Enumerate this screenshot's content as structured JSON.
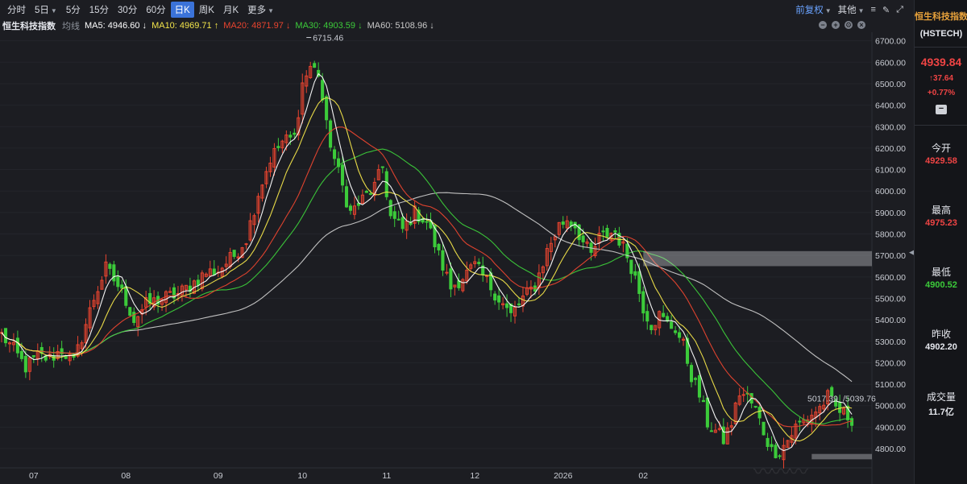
{
  "toolbar": {
    "items": [
      "分时",
      "5日",
      "5分",
      "15分",
      "30分",
      "60分",
      "日K",
      "周K",
      "月K",
      "更多"
    ],
    "active": "日K",
    "fuquan": "前复权",
    "other": "其他"
  },
  "legend": {
    "name": "恒生科技指数",
    "sub": "均线",
    "ma5": "MA5: 4946.60 ↓",
    "ma10": "MA10: 4969.71 ↑",
    "ma20": "MA20: 4871.97 ↓",
    "ma30": "MA30: 4903.59 ↓",
    "ma60": "MA60: 5108.96 ↓"
  },
  "colors": {
    "ma5": "#ffffff",
    "ma10": "#f2e44a",
    "ma20": "#e8442f",
    "ma30": "#3ccb3a",
    "ma60": "#c9c9c9",
    "up": "#e8442f",
    "down": "#3ccb3a"
  },
  "panel": {
    "title": "恒生科技指数",
    "code": "(HSTECH)",
    "price": "4939.84",
    "change": "↑37.64",
    "pct": "+0.77%",
    "open_label": "今开",
    "open": "4929.58",
    "high_label": "最高",
    "high": "4975.23",
    "low_label": "最低",
    "low": "4900.52",
    "prev_label": "昨收",
    "prev": "4902.20",
    "vol_label": "成交量",
    "vol": "11.7亿"
  },
  "chart_data": {
    "type": "candlestick",
    "y_ticks": [
      4800,
      4900,
      5000,
      5100,
      5200,
      5300,
      5400,
      5500,
      5600,
      5700,
      5800,
      5900,
      6000,
      6100,
      6200,
      6300,
      6400,
      6500,
      6600,
      6700
    ],
    "y_tick_labels": [
      "4800.00",
      "4900.00",
      "5000.00",
      "5100.00",
      "5200.00",
      "5300.00",
      "5400.00",
      "5500.00",
      "5600.00",
      "5700.00",
      "5800.00",
      "5900.00",
      "6000.00",
      "6100.00",
      "6200.00",
      "6300.00",
      "6400.00",
      "6500.00",
      "6600.00",
      "6700.00"
    ],
    "ylim": [
      4710,
      6740
    ],
    "x_labels": [
      "07",
      "08",
      "09",
      "10",
      "11",
      "12",
      "2026",
      "02"
    ],
    "x_label_days": [
      8,
      31,
      54,
      75,
      96,
      118,
      140,
      160
    ],
    "annotations": [
      {
        "text": "6715.46",
        "day": 76,
        "value": 6715.46
      },
      {
        "text": "5017.39",
        "day": 215,
        "value": 5017.39
      },
      {
        "text": "5039.76",
        "day": 218,
        "value": 5039.76
      }
    ],
    "close_keypoints": [
      [
        0,
        5330
      ],
      [
        3,
        5260
      ],
      [
        6,
        5180
      ],
      [
        9,
        5230
      ],
      [
        12,
        5220
      ],
      [
        15,
        5260
      ],
      [
        18,
        5200
      ],
      [
        20,
        5320
      ],
      [
        23,
        5500
      ],
      [
        26,
        5640
      ],
      [
        29,
        5560
      ],
      [
        31,
        5490
      ],
      [
        33,
        5400
      ],
      [
        36,
        5470
      ],
      [
        40,
        5500
      ],
      [
        44,
        5520
      ],
      [
        47,
        5560
      ],
      [
        51,
        5620
      ],
      [
        54,
        5630
      ],
      [
        58,
        5700
      ],
      [
        61,
        5780
      ],
      [
        64,
        5990
      ],
      [
        67,
        6150
      ],
      [
        70,
        6230
      ],
      [
        73,
        6250
      ],
      [
        75,
        6500
      ],
      [
        77,
        6580
      ],
      [
        79,
        6550
      ],
      [
        81,
        6300
      ],
      [
        83,
        6150
      ],
      [
        85,
        6020
      ],
      [
        87,
        5900
      ],
      [
        90,
        5960
      ],
      [
        93,
        6020
      ],
      [
        95,
        6110
      ],
      [
        97,
        5880
      ],
      [
        100,
        5820
      ],
      [
        103,
        5900
      ],
      [
        106,
        5860
      ],
      [
        109,
        5700
      ],
      [
        112,
        5550
      ],
      [
        115,
        5600
      ],
      [
        118,
        5650
      ],
      [
        121,
        5580
      ],
      [
        124,
        5500
      ],
      [
        127,
        5420
      ],
      [
        130,
        5500
      ],
      [
        133,
        5560
      ],
      [
        136,
        5720
      ],
      [
        139,
        5840
      ],
      [
        141,
        5870
      ],
      [
        143,
        5840
      ],
      [
        145,
        5760
      ],
      [
        147,
        5700
      ],
      [
        149,
        5780
      ],
      [
        151,
        5800
      ],
      [
        153,
        5810
      ],
      [
        156,
        5700
      ],
      [
        158,
        5600
      ],
      [
        160,
        5460
      ],
      [
        162,
        5380
      ],
      [
        164,
        5420
      ],
      [
        166,
        5380
      ],
      [
        168,
        5360
      ],
      [
        170,
        5280
      ],
      [
        172,
        5140
      ],
      [
        174,
        5050
      ],
      [
        176,
        4920
      ],
      [
        178,
        4880
      ],
      [
        180,
        4840
      ],
      [
        182,
        4920
      ],
      [
        184,
        5060
      ],
      [
        186,
        5040
      ],
      [
        188,
        4980
      ],
      [
        190,
        4880
      ],
      [
        192,
        4790
      ],
      [
        194,
        4790
      ],
      [
        196,
        4840
      ],
      [
        198,
        4900
      ],
      [
        200,
        4930
      ],
      [
        202,
        4960
      ],
      [
        204,
        4990
      ],
      [
        206,
        5040
      ],
      [
        208,
        4990
      ],
      [
        210,
        4960
      ],
      [
        212,
        4940
      ]
    ]
  }
}
